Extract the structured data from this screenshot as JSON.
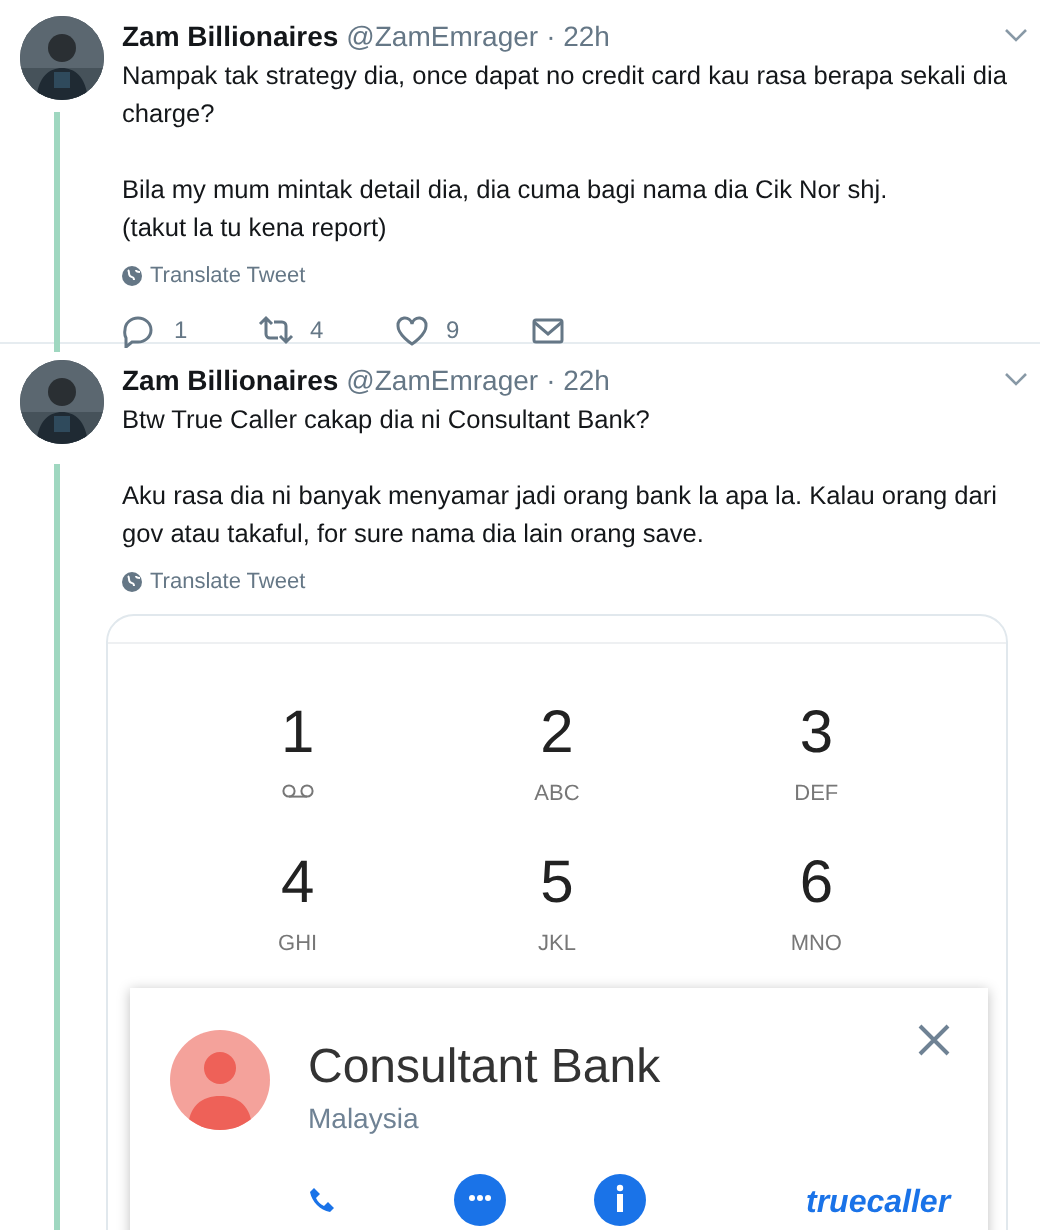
{
  "tweets": [
    {
      "author": "Zam Billionaires",
      "handle": "@ZamEmrager",
      "time": "· 22h",
      "paragraphs": [
        "Nampak tak strategy dia, once dapat no credit card kau rasa berapa sekali dia charge?",
        "Bila my mum mintak detail dia, dia cuma bagi nama dia Cik Nor shj.\n(takut la tu kena report)"
      ],
      "translate": "Translate Tweet",
      "actions": [
        {
          "kind": "reply",
          "count": "1"
        },
        {
          "kind": "retweet",
          "count": "4"
        },
        {
          "kind": "like",
          "count": "9"
        },
        {
          "kind": "message"
        }
      ]
    },
    {
      "author": "Zam Billionaires",
      "handle": "@ZamEmrager",
      "time": "· 22h",
      "paragraphs": [
        "Btw True Caller cakap dia ni Consultant Bank?",
        "Aku rasa dia ni banyak menyamar jadi orang bank la apa la. Kalau orang dari gov atau takaful, for sure nama dia lain orang save."
      ],
      "translate": "Translate Tweet",
      "media": {
        "keypad": [
          {
            "digit": "1",
            "kind": "voicemail"
          },
          {
            "digit": "2",
            "letters": "ABC",
            "kind": "letters"
          },
          {
            "digit": "3",
            "letters": "DEF",
            "kind": "letters"
          },
          {
            "digit": "4",
            "letters": "GHI",
            "kind": "letters"
          },
          {
            "digit": "5",
            "letters": "JKL",
            "kind": "letters"
          },
          {
            "digit": "6",
            "letters": "MNO",
            "kind": "letters"
          }
        ],
        "caller_card": {
          "name": "Consultant Bank",
          "location": "Malaysia",
          "brand": "truecaller"
        }
      }
    }
  ]
}
